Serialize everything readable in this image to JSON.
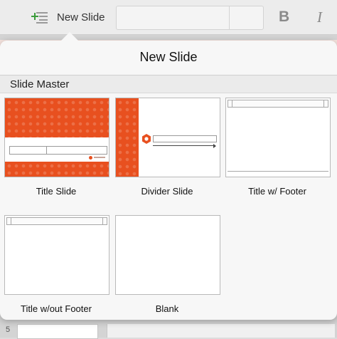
{
  "toolbar": {
    "new_slide_label": "New Slide",
    "new_slide_icon": "new-slide-icon",
    "bold_label": "B",
    "italic_label": "I"
  },
  "popover": {
    "title": "New Slide",
    "section_label": "Slide Master",
    "layouts": [
      {
        "label": "Title Slide",
        "thumb": "title-slide"
      },
      {
        "label": "Divider Slide",
        "thumb": "divider-slide"
      },
      {
        "label": "Title w/ Footer",
        "thumb": "title-footer"
      },
      {
        "label": "Title w/out Footer",
        "thumb": "title-no-footer"
      },
      {
        "label": "Blank",
        "thumb": "blank"
      }
    ]
  },
  "background": {
    "thumbnail_number": "5"
  },
  "colors": {
    "accent": "#e8501f",
    "popover_bg": "#f7f7f7",
    "section_bg": "#ebebeb"
  }
}
